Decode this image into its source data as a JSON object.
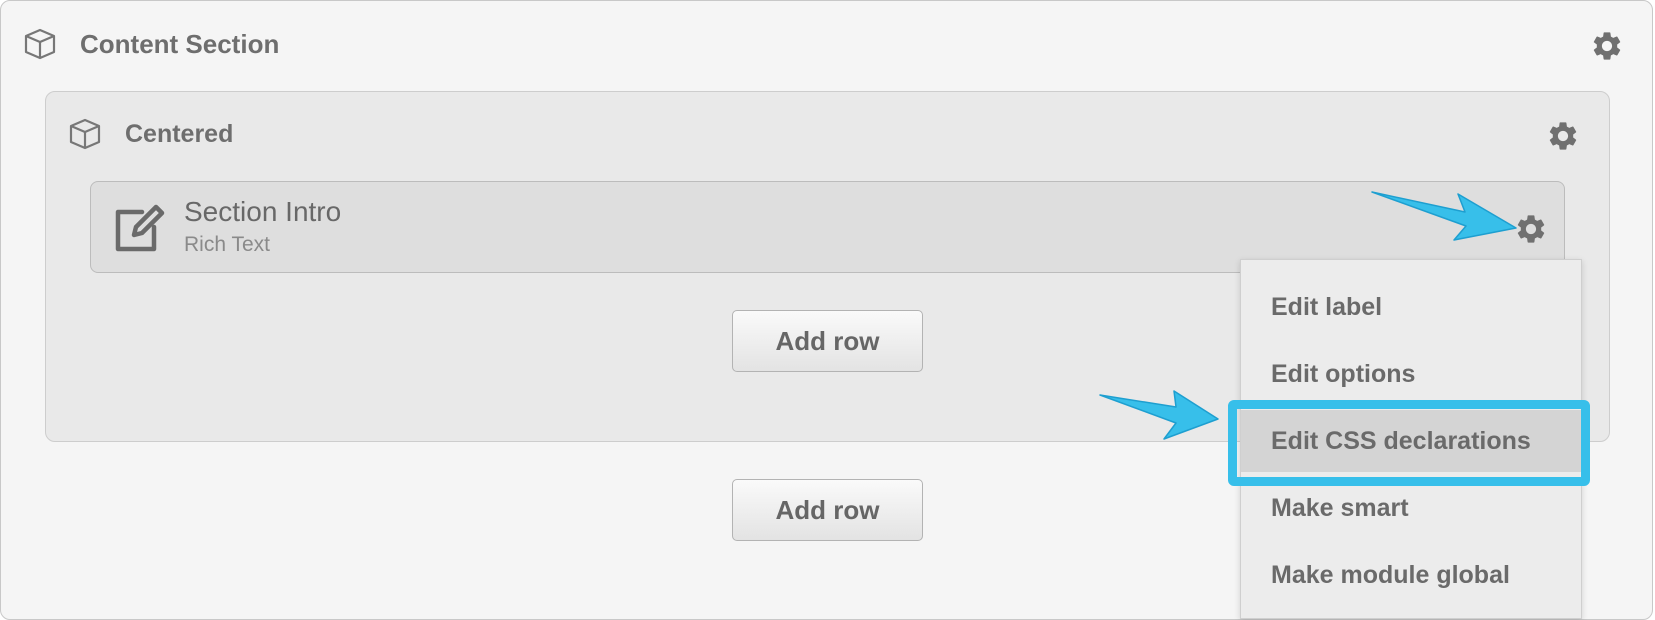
{
  "section": {
    "title": "Content Section"
  },
  "row": {
    "title": "Centered"
  },
  "module": {
    "title": "Section Intro",
    "subtitle": "Rich Text"
  },
  "buttons": {
    "add_row_inner": "Add row",
    "add_row_outer": "Add row"
  },
  "context_menu": {
    "items": [
      {
        "label": "Edit label"
      },
      {
        "label": "Edit options"
      },
      {
        "label": "Edit CSS declarations",
        "selected": true
      },
      {
        "label": "Make smart"
      },
      {
        "label": "Make module global"
      }
    ]
  },
  "colors": {
    "highlight": "#37bfea",
    "icon": "#707070"
  },
  "icons": [
    "cube-icon",
    "gear-icon",
    "edit-icon",
    "arrow-annotation"
  ]
}
